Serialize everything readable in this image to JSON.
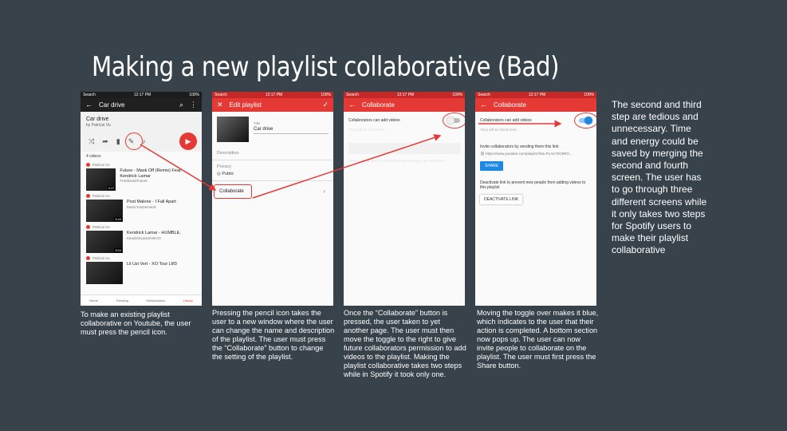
{
  "slide": {
    "title": "Making a new playlist collaborative (Bad)",
    "side_note": "The second and third step are tedious and unnecessary. Time and energy could be saved by merging the second and fourth screen. The user has to go through three different screens while it only takes two steps for Spotify users to make their playlist collaborative"
  },
  "captions": [
    "To make an existing playlist collaborative on Youtube, the user must press the pencil icon.",
    "Pressing the pencil icon takes the user to a new window where the user can change the name and description of the playlist. The user must press the “Collaborate” button to change the setting of the playlist.",
    "Once the “Collaborate” button is pressed, the user taken to yet another page. The user must then move the toggle to the right to give future collaborators permission to add videos to the playlist. Making the playlist collaborative takes two steps while in Spotify it took only one.",
    "Moving the toggle over makes it blue, which indicates to the user that their action is completed. A bottom section now pops up. The user can now invite people to collaborate on the playlist. The user must first press the Share button."
  ],
  "status": {
    "carrier": "Search",
    "time": "12:17 PM",
    "battery": "100%"
  },
  "phone1": {
    "title": "Car drive",
    "playlist_name": "Car drive",
    "playlist_by": "by Patricia Vu",
    "video_count": "4 videos",
    "videos": [
      {
        "by": "Patricia Vu",
        "name": "Future - Mask Off (Remix) Feat. Kendrick Lamar",
        "channel": "FreebandzFuture",
        "duration": "4:17"
      },
      {
        "by": "Patricia Vu",
        "name": "Post Malone - I Fall Apart",
        "channel": "MusicYouDemand",
        "duration": "3:44"
      },
      {
        "by": "Patricia Vu",
        "name": "Kendrick Lamar - HUMBLE.",
        "channel": "KendrickLamarVEVO",
        "duration": "3:04"
      },
      {
        "by": "Patricia Vu",
        "name": "Lil Uzi Vert - XO Tour Llif3",
        "channel": "",
        "duration": ""
      }
    ],
    "nav": [
      "Home",
      "Trending",
      "Subscriptions",
      "Library"
    ]
  },
  "phone2": {
    "title": "Edit playlist",
    "title_label": "Title",
    "title_value": "Car drive",
    "description_label": "Description",
    "privacy_label": "Privacy",
    "privacy_value": "Public",
    "collaborate_label": "Collaborate"
  },
  "phone3": {
    "title": "Collaborate",
    "toggle_label": "Collaborators can add videos",
    "listed_note": "They will be listed here.",
    "invite_faded": "Invite collaborators to add videos by sending a link with them",
    "toggle_on": false
  },
  "phone4": {
    "title": "Collaborate",
    "toggle_label": "Collaborators can add videos",
    "listed_note": "They will be listed here.",
    "invite_text": "Invite collaborators by sending them this link:",
    "link": "https://www.youtube.com/playlist?list=PLAU70C8RG...",
    "share_label": "SHARE",
    "deactivate_text": "Deactivate link to prevent new people from adding videos to this playlist",
    "deactivate_label": "DEACTIVATE LINK",
    "toggle_on": true
  },
  "colors": {
    "background": "#37424a",
    "youtube_red": "#e53935",
    "toggle_blue": "#1e88e5"
  }
}
